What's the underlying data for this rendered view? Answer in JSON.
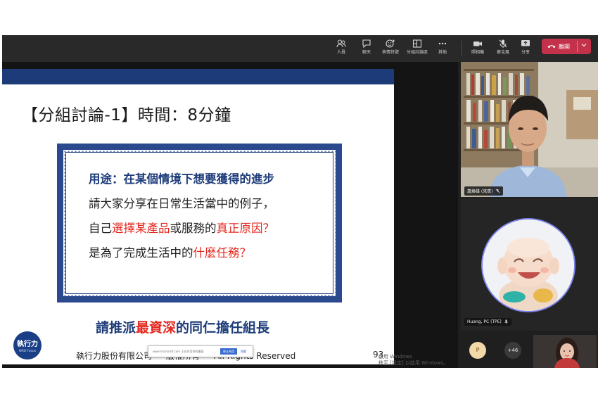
{
  "toolbar": {
    "people": "人員",
    "chat": "聊天",
    "reactions": "表情符號",
    "rooms": "分組討論區",
    "more": "其他",
    "camera": "照相機",
    "mic": "麥克風",
    "share": "分享",
    "leave": "離開"
  },
  "slide": {
    "title": "【分組討論-1】時間：8分鐘",
    "heading": "用途：在某個情境下想要獲得的進步",
    "line1": "請大家分享在日常生活當中的例子，",
    "line2_a": "自己",
    "line2_b": "選擇某產品",
    "line2_c": "或服務的",
    "line2_d": "真正原因？",
    "line3_a": "是為了完成生活中的",
    "line3_b": "什麼任務？",
    "assign_a": "請推派",
    "assign_b": "最資深",
    "assign_c": "的同仁擔任組長",
    "logo_main": "執行力",
    "logo_sub": "HRD Focus",
    "footer_company": "執行力股份有限公司",
    "footer_rights": "版權所有",
    "footer_reserved": "All Rights Reserved",
    "page_number": "93"
  },
  "popup": {
    "text": "www.microsoft.com 正在共用你的畫面",
    "stop": "停止共用",
    "hide": "隱藏"
  },
  "watermark": {
    "line1": "啟用 Windows",
    "line2": "移至 [設定] 以啟用 Windows。"
  },
  "participants": {
    "presenter_name": "蕭煥雄 (來賓)",
    "host_name": "Huang, PC (TPE)",
    "p_initial": "P",
    "more_count": "+46"
  },
  "colors": {
    "accent_blue": "#1d3b78",
    "highlight_red": "#e5281f",
    "leave_red": "#c4314b",
    "ring": "#7b83eb"
  }
}
